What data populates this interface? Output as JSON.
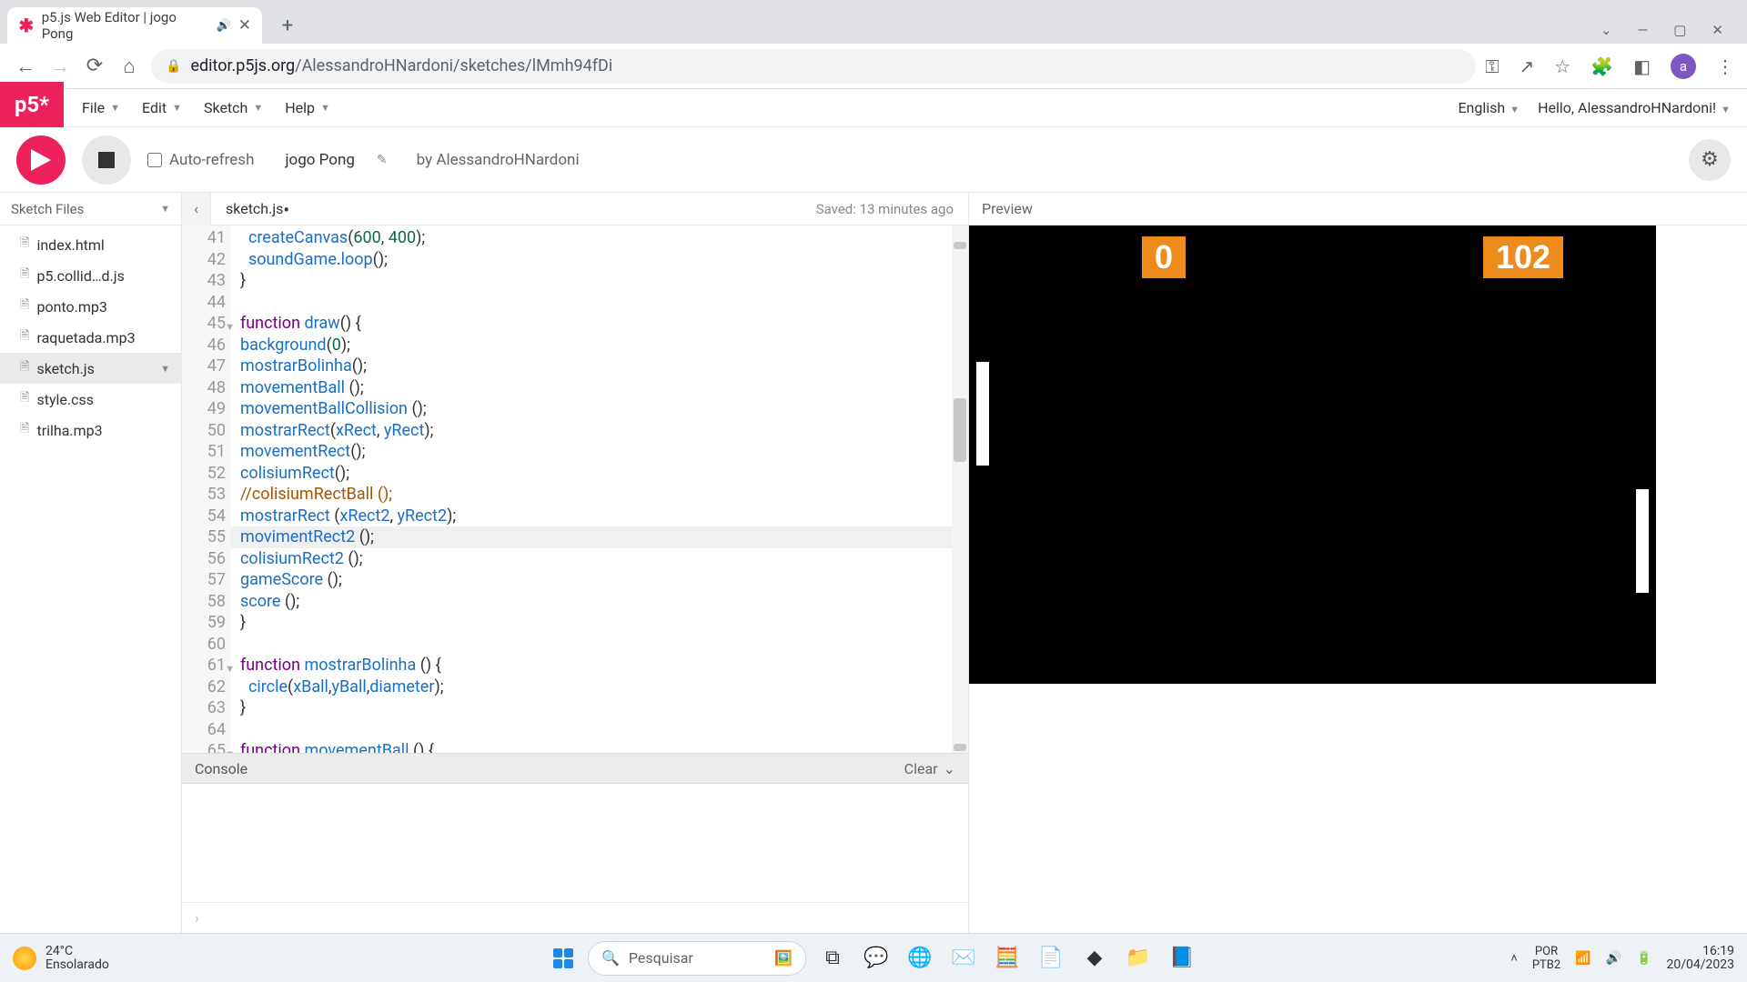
{
  "browser": {
    "tab_title": "p5.js Web Editor | jogo Pong",
    "url_host": "editor.p5js.org",
    "url_path": "/AlessandroHNardoni/sketches/lMmh94fDi"
  },
  "menubar": {
    "logo": "p5*",
    "file": "File",
    "edit": "Edit",
    "sketch": "Sketch",
    "help": "Help",
    "language": "English",
    "greeting": "Hello, AlessandroHNardoni!"
  },
  "toolbar": {
    "auto_refresh": "Auto-refresh",
    "sketch_name": "jogo Pong",
    "by": "by AlessandroHNardoni"
  },
  "sidebar": {
    "header": "Sketch Files",
    "files": [
      {
        "name": "index.html"
      },
      {
        "name": "p5.collid…d.js"
      },
      {
        "name": "ponto.mp3"
      },
      {
        "name": "raquetada.mp3"
      },
      {
        "name": "sketch.js",
        "active": true
      },
      {
        "name": "style.css"
      },
      {
        "name": "trilha.mp3"
      }
    ]
  },
  "editor": {
    "filename": "sketch.js",
    "saved": "Saved: 13 minutes ago",
    "first_line": 41,
    "console_label": "Console",
    "clear_label": "Clear"
  },
  "preview": {
    "label": "Preview",
    "score_left": "0",
    "score_right": "102"
  },
  "taskbar": {
    "temp": "24°C",
    "cond": "Ensolarado",
    "search_placeholder": "Pesquisar",
    "lang1": "POR",
    "lang2": "PTB2",
    "time": "16:19",
    "date": "20/04/2023"
  }
}
